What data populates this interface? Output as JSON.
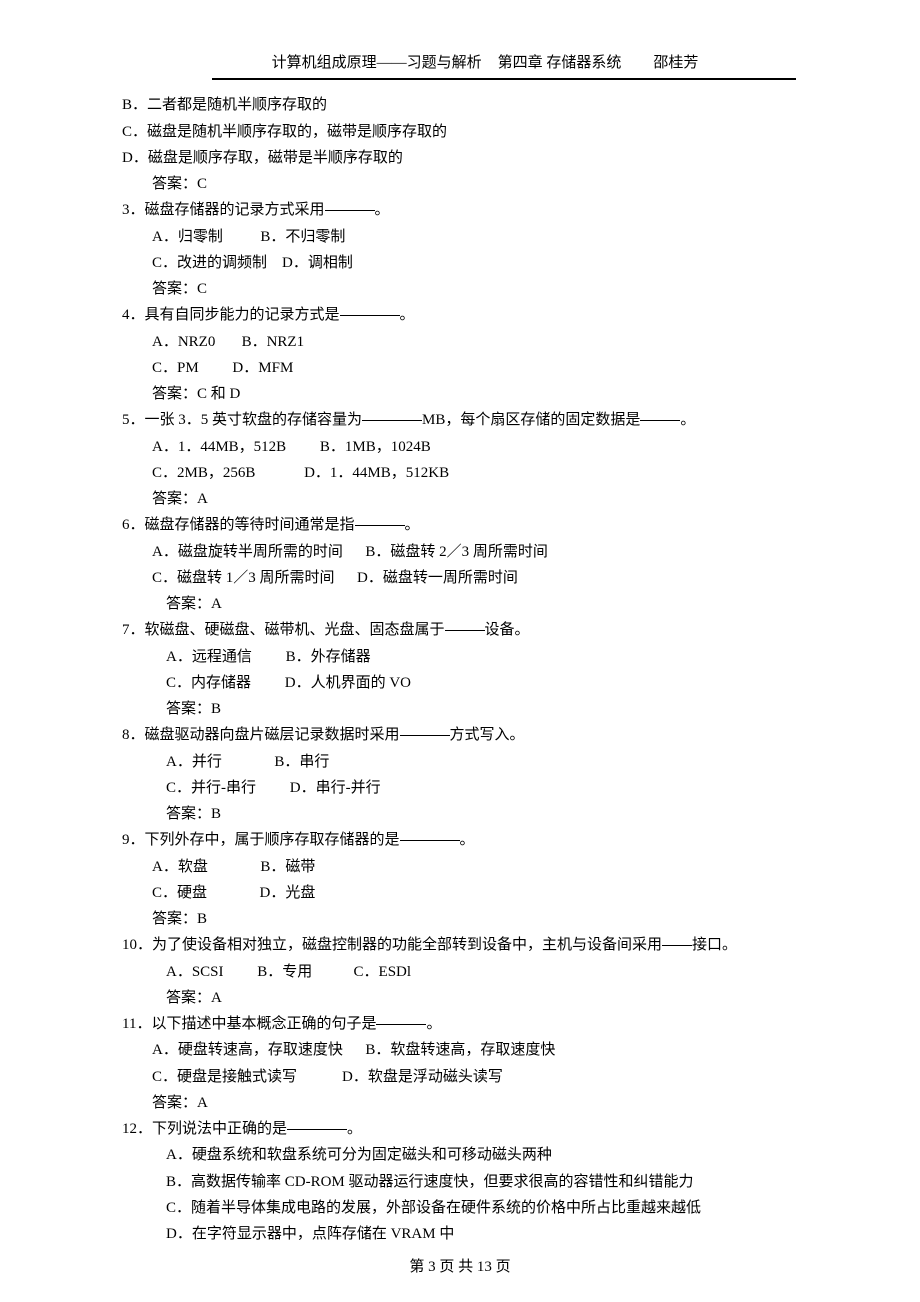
{
  "header": {
    "title": "计算机组成原理——习题与解析",
    "chapter": "第四章 存储器系统",
    "author": "邵桂芳"
  },
  "footer": {
    "prefix": "第",
    "cur": "3",
    "mid": "页 共",
    "total": "13",
    "suffix": "页"
  },
  "pre": {
    "opt_b": "B．二者都是随机半顺序存取的",
    "opt_c": "C．磁盘是随机半顺序存取的，磁带是顺序存取的",
    "opt_d": "D．磁盘是顺序存取，磁带是半顺序存取的",
    "ans": "答案：C"
  },
  "q3": {
    "stem_a": "3．磁盘存储器的记录方式采用",
    "stem_b": "。",
    "row1": "A．归零制          B．不归零制",
    "row2": "C．改进的调频制    D．调相制",
    "ans": "答案：C"
  },
  "q4": {
    "stem_a": "4．具有自同步能力的记录方式是",
    "stem_b": "。",
    "row1": "A．NRZ0       B．NRZ1",
    "row2": "C．PM         D．MFM",
    "ans": "答案：C 和 D"
  },
  "q5": {
    "stem_a": "5．一张 3．5 英寸软盘的存储容量为",
    "stem_b": "MB，每个扇区存储的固定数据是",
    "stem_c": "。",
    "row1": "A．1．44MB，512B         B．1MB，1024B",
    "row2": "C．2MB，256B             D．1．44MB，512KB",
    "ans": "答案：A"
  },
  "q6": {
    "stem_a": "6．磁盘存储器的等待时间通常是指",
    "stem_b": "。",
    "row1": "A．磁盘旋转半周所需的时间      B．磁盘转 2／3 周所需时间",
    "row2": "C．磁盘转 1／3 周所需时间      D．磁盘转一周所需时间",
    "ans": "答案：A"
  },
  "q7": {
    "stem_a": "7．软磁盘、硬磁盘、磁带机、光盘、固态盘属于",
    "stem_b": "设备。",
    "row1": "A．远程通信         B．外存储器",
    "row2": "C．内存储器         D．人机界面的 VO",
    "ans": "答案：B"
  },
  "q8": {
    "stem_a": "8．磁盘驱动器向盘片磁层记录数据时采用",
    "stem_b": "方式写入。",
    "row1": "A．并行              B．串行",
    "row2": "C．并行-串行         D．串行-并行",
    "ans": "答案：B"
  },
  "q9": {
    "stem_a": "9．下列外存中，属于顺序存取存储器的是",
    "stem_b": "。",
    "row1": "A．软盘              B．磁带",
    "row2": "C．硬盘              D．光盘",
    "ans": "答案：B"
  },
  "q10": {
    "stem_a": "10．为了使设备相对独立，磁盘控制器的功能全部转到设备中，主机与设备间采用",
    "stem_b": "接口。",
    "row1": "A．SCSI         B．专用           C．ESDl",
    "ans": "答案：A"
  },
  "q11": {
    "stem_a": "11．以下描述中基本概念正确的句子是",
    "stem_b": "。",
    "row1": "A．硬盘转速高，存取速度快      B．软盘转速高，存取速度快",
    "row2": "C．硬盘是接触式读写            D．软盘是浮动磁头读写",
    "ans": "答案：A"
  },
  "q12": {
    "stem_a": "12．下列说法中正确的是",
    "stem_b": "。",
    "opt_a": "A．硬盘系统和软盘系统可分为固定磁头和可移动磁头两种",
    "opt_b": "B．高数据传输率 CD-ROM 驱动器运行速度快，但要求很高的容错性和纠错能力",
    "opt_c": "C．随着半导体集成电路的发展，外部设备在硬件系统的价格中所占比重越来越低",
    "opt_d": "D．在字符显示器中，点阵存储在 VRAM 中"
  }
}
